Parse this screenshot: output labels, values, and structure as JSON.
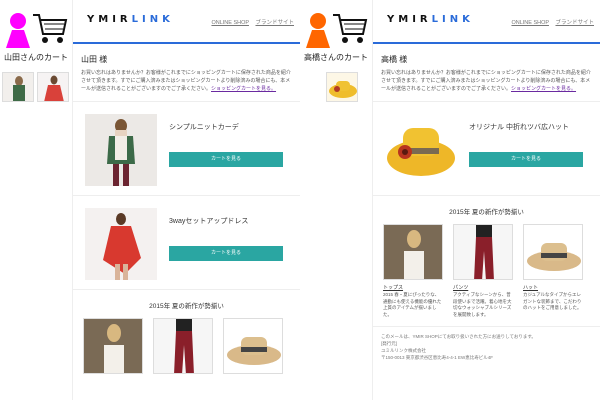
{
  "left": {
    "cart_title": "山田さんのカート",
    "person_color": "#ff00ff"
  },
  "left_email": {
    "logo_a": "YMIR",
    "logo_b": "LINK",
    "link_shop": "ONLINE SHOP",
    "link_brand": "ブランドサイト",
    "greeting": "山田 様",
    "message": "お買い忘れはありませんか？お客様がこれまでにショッピングカートに保存された商品を紹介させて頂きます。すでにご購入済みまたはショッピングカートより削除済みの場合にも、本メールが送信されることがございますのでご了承ください。",
    "message_link": "ショッピングカートを見る。",
    "products": [
      {
        "name": "シンプルニットカーデ",
        "button": "カートを見る"
      },
      {
        "name": "3wayセットアップドレス",
        "button": "カートを見る"
      }
    ],
    "new_title": "2015年 夏の新作が勢揃い"
  },
  "right": {
    "cart_title": "高橋さんのカート",
    "person_color": "#ff6600"
  },
  "right_email": {
    "logo_a": "YMIR",
    "logo_b": "LINK",
    "link_shop": "ONLINE SHOP",
    "link_brand": "ブランドサイト",
    "greeting": "高橋 様",
    "message": "お買い忘れはありませんか？お客様がこれまでにショッピングカートに保存された商品を紹介させて頂きます。すでにご購入済みまたはショッピングカートより削除済みの場合にも、本メールが送信されることがございますのでご了承ください。",
    "message_link": "ショッピングカートを見る。",
    "products": [
      {
        "name": "オリジナル 中折れツバ広ハット",
        "button": "カートを見る"
      }
    ],
    "new_title": "2015年 夏の新作が勢揃い",
    "items": [
      {
        "cat": "トップス",
        "desc": "2015 春・夏にぴったりな、通勤にも使える機能の優れた上質のアイテムが揃いました。"
      },
      {
        "cat": "パンツ",
        "desc": "アクティブなシーンから、普段使いまで活躍。着心地を大切なウォッシャブルシリーズを展開致します。"
      },
      {
        "cat": "ハット",
        "desc": "カジュアルなタイプからエレガントな装飾まで、こだわりのハットをご用意しました。"
      }
    ],
    "footer_1": "このメールは、YMIR SHOPにてお取り扱いされた方にお送りしております。",
    "footer_2": "[発行元]",
    "footer_3": "ユミルリンク株式会社",
    "footer_4": "〒150-0013 東京都渋谷区恵比寿4-4-1 EW恵比寿ビル4F"
  }
}
